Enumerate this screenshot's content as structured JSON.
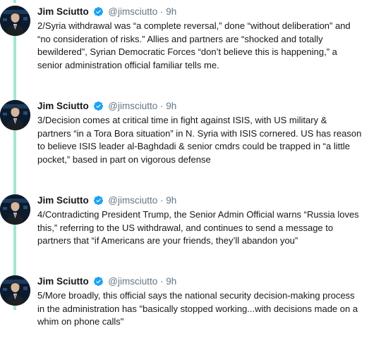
{
  "tweets": [
    {
      "name": "Jim Sciutto",
      "handle": "@jimsciutto",
      "separator": "·",
      "time": "9h",
      "text": "2/Syria withdrawal was “a complete reversal,” done “without deliberation” and “no consideration of risks.” Allies and partners are “shocked and totally bewildered”, Syrian Democratic Forces “don’t believe this is happening,” a senior administration official familiar tells me."
    },
    {
      "name": "Jim Sciutto",
      "handle": "@jimsciutto",
      "separator": "·",
      "time": "9h",
      "text": "3/Decision comes at critical time in fight against ISIS, with US military & partners “in a Tora Bora situation” in N. Syria with ISIS cornered. US has reason to believe ISIS leader al-Baghdadi & senior cmdrs could be trapped in “a little pocket,” based in part on vigorous defense"
    },
    {
      "name": "Jim Sciutto",
      "handle": "@jimsciutto",
      "separator": "·",
      "time": "9h",
      "text": "4/Contradicting President Trump, the Senior Admin Official warns “Russia loves this,” referring to the US withdrawal, and continues to send a message to partners that “if Americans are your friends, they’ll abandon you”"
    },
    {
      "name": "Jim Sciutto",
      "handle": "@jimsciutto",
      "separator": "·",
      "time": "9h",
      "text": "5/More broadly, this official says the national security decision-making process in the administration has \"basically stopped working...with decisions made on a whim on phone calls\""
    }
  ],
  "colors": {
    "thread_line": "#a4e6d1",
    "verified_badge": "#1da1f2",
    "secondary_text": "#657786"
  },
  "icons": {
    "verified": "verified-badge-icon",
    "avatar": "profile-photo"
  }
}
